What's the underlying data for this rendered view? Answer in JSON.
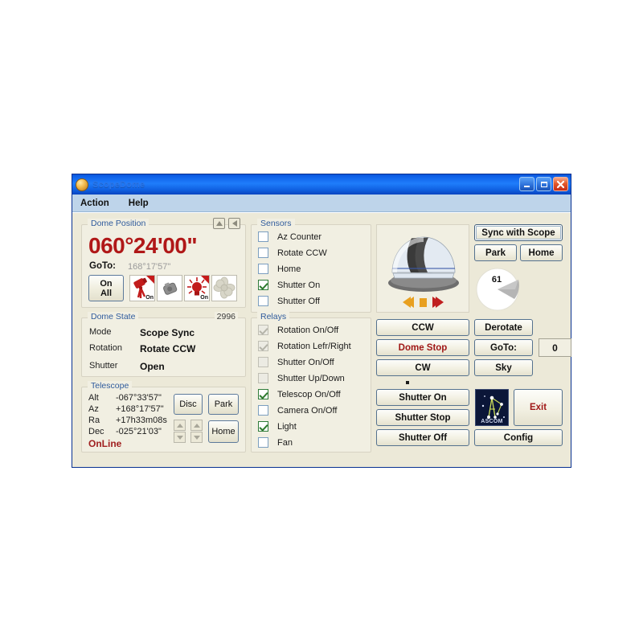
{
  "window": {
    "title": "ScopeDome",
    "icon": "dome-app-icon",
    "controls": {
      "minimize": "minimize-icon",
      "maximize": "maximize-icon",
      "close": "close-icon"
    }
  },
  "menu": {
    "items": [
      "Action",
      "Help"
    ]
  },
  "dome_position": {
    "legend": "Dome Position",
    "value": "060°24'00\"",
    "goto_label": "GoTo:",
    "goto_value": "168°17'57\"",
    "header_buttons": [
      "up-arrow-icon",
      "left-arrow-icon"
    ],
    "on_all_label": "On\nAll",
    "on_all_line1": "On",
    "on_all_line2": "All",
    "icon_buttons": [
      {
        "name": "telescope-relay-icon",
        "tag": "On",
        "active": true
      },
      {
        "name": "camera-relay-icon",
        "tag": "",
        "active": false
      },
      {
        "name": "light-relay-icon",
        "tag": "On",
        "active": true
      },
      {
        "name": "fan-relay-icon",
        "tag": "",
        "active": false
      }
    ]
  },
  "dome_state": {
    "legend": "Dome State",
    "counter": "2996",
    "rows": [
      {
        "label": "Mode",
        "value": "Scope Sync"
      },
      {
        "label": "Rotation",
        "value": "Rotate CCW"
      },
      {
        "label": "Shutter",
        "value": "Open"
      }
    ]
  },
  "telescope": {
    "legend": "Telescope",
    "rows": [
      {
        "label": "Alt",
        "value": "-067°33'57\""
      },
      {
        "label": "Az",
        "value": "+168°17'57\""
      },
      {
        "label": "Ra",
        "value": "+17h33m08s"
      },
      {
        "label": "Dec",
        "value": "-025°21'03\""
      }
    ],
    "status": "OnLine",
    "buttons": {
      "disc": "Disc",
      "park": "Park",
      "home": "Home"
    }
  },
  "sensors": {
    "legend": "Sensors",
    "items": [
      {
        "label": "Az Counter",
        "checked": false,
        "disabled": false
      },
      {
        "label": "Rotate CCW",
        "checked": false,
        "disabled": false
      },
      {
        "label": "Home",
        "checked": false,
        "disabled": false
      },
      {
        "label": "Shutter On",
        "checked": true,
        "disabled": false
      },
      {
        "label": "Shutter Off",
        "checked": false,
        "disabled": false
      }
    ]
  },
  "relays": {
    "legend": "Relays",
    "items": [
      {
        "label": "Rotation On/Off",
        "checked": true,
        "disabled": true
      },
      {
        "label": "Rotation Lefr/Right",
        "checked": true,
        "disabled": true
      },
      {
        "label": "Shutter On/Off",
        "checked": false,
        "disabled": true
      },
      {
        "label": "Shutter Up/Down",
        "checked": false,
        "disabled": true
      },
      {
        "label": "Telescop On/Off",
        "checked": true,
        "disabled": false
      },
      {
        "label": "Camera On/Off",
        "checked": false,
        "disabled": false
      },
      {
        "label": "Light",
        "checked": true,
        "disabled": false
      },
      {
        "label": "Fan",
        "checked": false,
        "disabled": false
      }
    ]
  },
  "dome_picture": {
    "name": "dome-illustration",
    "controls": [
      "rewind-icon",
      "stop-icon",
      "fast-forward-icon"
    ]
  },
  "scope_panel": {
    "sync_with_scope": "Sync with Scope",
    "park": "Park",
    "home": "Home",
    "gauge_value": "61"
  },
  "rotation_controls": {
    "ccw": "CCW",
    "dome_stop": "Dome Stop",
    "cw": "CW",
    "derotate": "Derotate",
    "goto": "GoTo:",
    "sky": "Sky",
    "goto_field_value": "0"
  },
  "shutter_controls": {
    "shutter_on": "Shutter On",
    "shutter_stop": "Shutter Stop",
    "shutter_off": "Shutter Off",
    "ascom_label": "ASCOM",
    "exit": "Exit",
    "config": "Config"
  },
  "colors": {
    "titlebar_blue": "#1f7dfb",
    "window_border": "#0a38c8",
    "client_bg": "#ece9d8",
    "group_bg": "#f1efe2",
    "accent_red": "#b01818",
    "legend_blue": "#2f5b9c",
    "check_green": "#2d7a2d"
  }
}
